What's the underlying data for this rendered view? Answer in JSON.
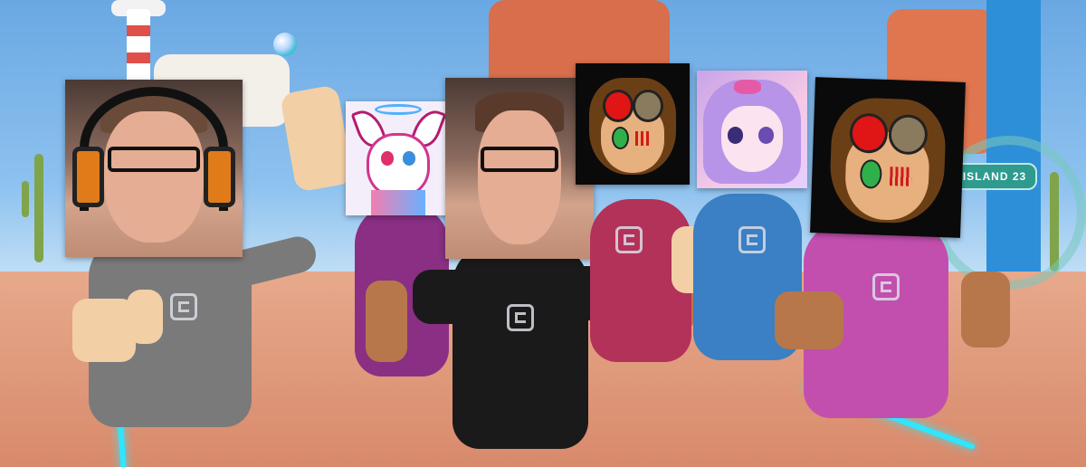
{
  "scene": {
    "island_sign": "ISLAND  23"
  },
  "avatars": [
    {
      "face": "webcam-photo-headphones",
      "shirt_color": "#7a7a7a"
    },
    {
      "face": "anime-creature-halo",
      "shirt_color": "#8a2f84"
    },
    {
      "face": "webcam-photo-glasses",
      "shirt_color": "#1a1a1a"
    },
    {
      "face": "cartoon-goggles",
      "shirt_color": "#b3325a"
    },
    {
      "face": "anime-purple-girl",
      "shirt_color": "#3b7fc4"
    },
    {
      "face": "cartoon-goggles",
      "shirt_color": "#c24fae"
    }
  ],
  "colors": {
    "path_glow": "#2fe6ff",
    "skin_light": "#f3cfa6",
    "skin_tan": "#b7774a"
  }
}
